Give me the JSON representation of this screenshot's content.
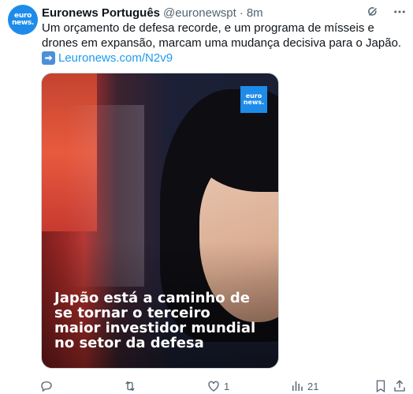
{
  "tweet": {
    "avatar_text": [
      "euro",
      "news."
    ],
    "author_name": "Euronews Português",
    "handle": "@euronewspt",
    "separator": "·",
    "time": "8m",
    "text": "Um orçamento de defesa recorde, e um programa de mísseis e drones em expansão, marcam uma mudança decisiva para o Japão.",
    "link_text": "Leuronews.com/N2v9"
  },
  "media": {
    "logo_text": [
      "euro",
      "news."
    ],
    "headline": "Japão está a caminho de se tornar o terceiro maior investidor mundial no setor da defesa"
  },
  "actions": {
    "reply_count": "",
    "retweet_count": "",
    "like_count": "1",
    "views_count": "21"
  },
  "icons": {
    "grok": "grok-icon",
    "more": "more-icon",
    "reply": "reply-icon",
    "retweet": "retweet-icon",
    "like": "heart-icon",
    "views": "views-icon",
    "bookmark": "bookmark-icon",
    "share": "share-icon",
    "link_arrow": "arrow-right-icon"
  },
  "colors": {
    "brand": "#1e8bea",
    "link": "#1d9bf0",
    "muted": "#536471"
  }
}
